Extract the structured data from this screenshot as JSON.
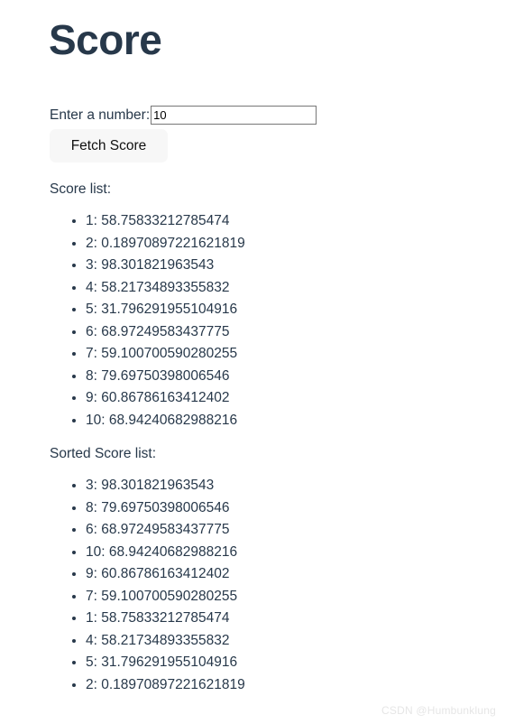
{
  "page": {
    "title": "Score"
  },
  "form": {
    "label": "Enter a number:",
    "input_value": "10",
    "input_placeholder": "",
    "button_label": "Fetch Score"
  },
  "score_section": {
    "heading": "Score list:",
    "items": [
      "1: 58.75833212785474",
      "2: 0.18970897221621819",
      "3: 98.301821963543",
      "4: 58.21734893355832",
      "5: 31.796291955104916",
      "6: 68.97249583437775",
      "7: 59.100700590280255",
      "8: 79.69750398006546",
      "9: 60.86786163412402",
      "10: 68.94240682988216"
    ]
  },
  "sorted_section": {
    "heading": "Sorted Score list:",
    "items": [
      "3: 98.301821963543",
      "8: 79.69750398006546",
      "6: 68.97249583437775",
      "10: 68.94240682988216",
      "9: 60.86786163412402",
      "7: 59.100700590280255",
      "1: 58.75833212785474",
      "4: 58.21734893355832",
      "5: 31.796291955104916",
      "2: 0.18970897221621819"
    ]
  },
  "watermark": {
    "text": "CSDN @Humbunklung"
  },
  "colors": {
    "heading": "#27384a",
    "text": "#27384a",
    "button_bg": "#f7f7f7",
    "input_border": "#777777",
    "watermark": "#e6e6e6",
    "background": "#ffffff"
  }
}
